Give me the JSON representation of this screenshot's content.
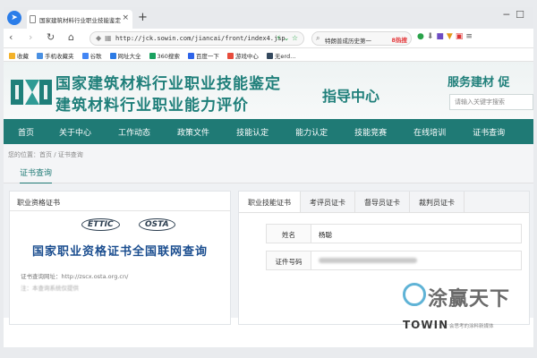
{
  "browser": {
    "tab_title": "国家建筑材料行业职业技能鉴定",
    "url": "http://jck.sowin.com/jiancai/front/index4.jsp",
    "search_text": "特朗普成历史第一",
    "search_badge": "8热搜",
    "bookmarks": [
      {
        "label": "收藏",
        "color": "#f3b22a"
      },
      {
        "label": "手机收藏夹",
        "color": "#4a90e2"
      },
      {
        "label": "谷歌",
        "color": "#4285f4"
      },
      {
        "label": "网址大全",
        "color": "#2c7be5"
      },
      {
        "label": "360搜索",
        "color": "#19a15f"
      },
      {
        "label": "百度一下",
        "color": "#2e64e9"
      },
      {
        "label": "游戏中心",
        "color": "#e74c3c"
      },
      {
        "label": "无erd…",
        "color": "#34495e"
      }
    ]
  },
  "site": {
    "title_line1": "国家建筑材料行业职业技能鉴定",
    "title_line2": "建筑材料行业职业能力评价",
    "title_line3": "指导中心",
    "service_label": "服务建材  促",
    "search_placeholder": "请输入关键字搜索"
  },
  "nav": [
    "首页",
    "关于中心",
    "工作动态",
    "政策文件",
    "技能认定",
    "能力认定",
    "技能竞赛",
    "在线培训",
    "证书查询"
  ],
  "breadcrumb": "您的位置：首页 / 证书查询",
  "page_tab": "证书查询",
  "left_panel": {
    "title": "职业资格证书",
    "logo_a": "ETTIC",
    "logo_b": "OSTA",
    "heading": "国家职业资格证书全国联网查询",
    "url_line": "证书查询网址：http://zscx.osta.org.cn/",
    "blur_line": "注：本查询系统仅提供"
  },
  "right_panel": {
    "tabs": [
      "职业技能证书",
      "考评员证卡",
      "督导员证卡",
      "裁判员证卡"
    ],
    "name_label": "姓名",
    "name_value": "杨聪",
    "cert_label": "证件号码"
  },
  "watermark": {
    "cn": "涂赢天下",
    "en": "TOWIN",
    "sub": "会思考的涂料新媒体"
  }
}
